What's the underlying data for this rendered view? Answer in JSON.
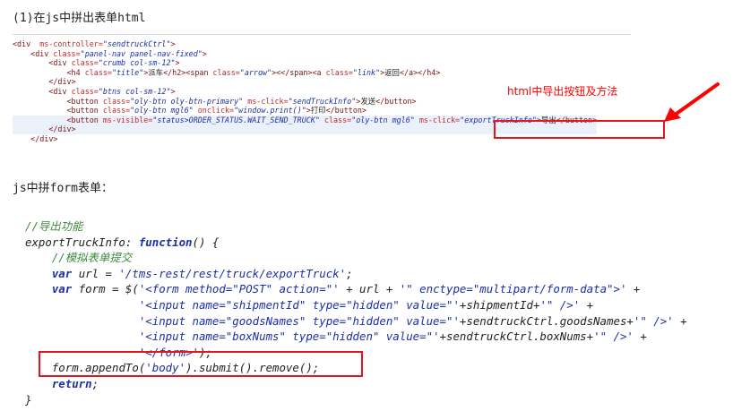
{
  "section1_heading": "(1)在js中拼出表单html",
  "section2_heading": "js中拼form表单：",
  "annotation_text": "html中导出按钮及方法",
  "html_code": {
    "l1": {
      "t1": "<div",
      "a1": "ms-controller=",
      "v1": "\"sendtruckCtrl\"",
      "t2": ">"
    },
    "l2": {
      "t1": "<div",
      "a1": "class=",
      "v1": "\"panel-nav panel-nav-fixed\"",
      "t2": ">"
    },
    "l3": {
      "t1": "<div",
      "a1": "class=",
      "v1": "\"crumb col-sm-12\"",
      "t2": ">"
    },
    "l4": {
      "t1": "<h4",
      "a1": "class=",
      "v1": "\"title\"",
      "t2": ">",
      "p1": "派车",
      "t3": "</h2><span",
      "a2": "class=",
      "v2": "\"arrow\"",
      "t4": "><</span><a",
      "a3": "class=",
      "v3": "\"link\"",
      "t5": ">",
      "p2": "返回",
      "t6": "</a></h4>"
    },
    "l5": {
      "t1": "</div>"
    },
    "l6": {
      "t1": "<div",
      "a1": "class=",
      "v1": "\"btns col-sm-12\"",
      "t2": ">"
    },
    "l7": {
      "t1": "<button",
      "a1": "class=",
      "v1": "\"oly-btn oly-btn-primary\"",
      "a2": "ms-click=",
      "v2": "\"sendTruckInfo\"",
      "t2": ">",
      "p1": "发送",
      "t3": "</button>"
    },
    "l8": {
      "t1": "<button",
      "a1": "class=",
      "v1": "\"oly-btn mgl6\"",
      "a2": "onclick=",
      "v2": "\"window.print()\"",
      "t2": ">",
      "p1": "打印",
      "t3": "</button>"
    },
    "l9": {
      "t1": "<button",
      "a1": "ms-visible=",
      "v1": "\"status>ORDER_STATUS.WAIT_SEND_TRUCK\"",
      "a2": "class=",
      "v2": "\"oly-btn mgl6\"",
      "a3": "ms-click=",
      "v3": "\"exportTruckInfo\"",
      "t2": ">",
      "p1": "导出",
      "t3": "</button>"
    },
    "l10": {
      "t1": "</div>"
    },
    "l11": {
      "t1": "</div>"
    }
  },
  "js_code": {
    "l1": {
      "c": "//导出功能"
    },
    "l2": {
      "id": "exportTruckInfo: ",
      "kw": "function",
      "rest": "() {"
    },
    "l3": {
      "c": "//模拟表单提交"
    },
    "l4": {
      "kw": "var",
      "id": " url = ",
      "s": "'/tms-rest/rest/truck/exportTruck'",
      "rest": ";"
    },
    "l5": {
      "kw": "var",
      "id": " form = $(",
      "s1": "'<form method=\"POST\" action=\"'",
      "m1": " + url + ",
      "s2": "'\" enctype=\"multipart/form-data\">'",
      "m2": " +"
    },
    "l6": {
      "s1": "'<input name=\"shipmentId\" type=\"hidden\" value=\"'",
      "m1": "+shipmentId+",
      "s2": "'\" />'",
      "m2": " +"
    },
    "l7": {
      "s1": "'<input name=\"goodsNames\" type=\"hidden\" value=\"'",
      "m1": "+sendtruckCtrl.goodsNames+",
      "s2": "'\" />'",
      "m2": " +"
    },
    "l8": {
      "s1": "'<input name=\"boxNums\" type=\"hidden\" value=\"'",
      "m1": "+sendtruckCtrl.boxNums+",
      "s2": "'\" />'",
      "m2": " +"
    },
    "l9": {
      "s": "'</form>'",
      "rest": ");"
    },
    "l10": {
      "id": "form.appendTo(",
      "s": "'body'",
      "rest": ").submit().remove();"
    },
    "l11": {
      "kw": "return",
      "rest": ";"
    },
    "l12": {
      "rest": "}"
    }
  },
  "colors": {
    "highlight_red": "#e8141c",
    "annotation_red": "#ff0000",
    "keyword_blue": "#1a2fa8",
    "comment_green": "#3e8a3e",
    "tag_maroon": "#7a1212"
  }
}
